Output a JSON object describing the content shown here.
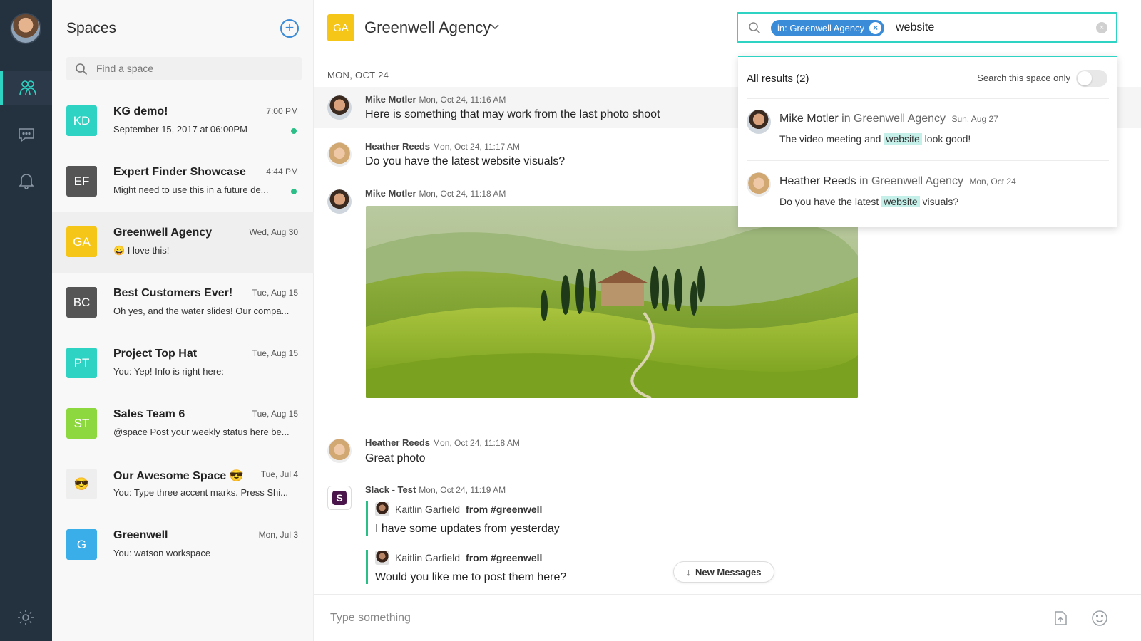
{
  "nav": {
    "items": [
      "spaces",
      "messages",
      "notifications"
    ],
    "active": "spaces"
  },
  "spaces_panel": {
    "title": "Spaces",
    "search_placeholder": "Find a space",
    "items": [
      {
        "initials": "KD",
        "name": "KG demo!",
        "time": "7:00 PM",
        "snippet": "September 15, 2017 at 06:00PM",
        "color": "#2ed3c3",
        "unread": true
      },
      {
        "initials": "EF",
        "name": "Expert Finder Showcase",
        "time": "4:44 PM",
        "snippet": "Might need to use this in a future de...",
        "color": "#555555",
        "unread": true
      },
      {
        "initials": "GA",
        "name": "Greenwell Agency",
        "time": "Wed, Aug 30",
        "snippet": "😀 I love this!",
        "color": "#f5c518",
        "unread": false
      },
      {
        "initials": "BC",
        "name": "Best Customers Ever!",
        "time": "Tue, Aug 15",
        "snippet": "Oh yes, and the water slides! Our compa...",
        "color": "#555555",
        "unread": false
      },
      {
        "initials": "PT",
        "name": "Project Top Hat",
        "time": "Tue, Aug 15",
        "snippet": "You: Yep! Info is right here:",
        "color": "#2ed3c3",
        "unread": false
      },
      {
        "initials": "ST",
        "name": "Sales Team 6",
        "time": "Tue, Aug 15",
        "snippet": "@space Post your weekly status here be...",
        "color": "#8ed83f",
        "unread": false
      },
      {
        "initials": "😎",
        "name": "Our Awesome Space 😎",
        "time": "Tue, Jul 4",
        "snippet": "You: Type three accent marks. Press Shi...",
        "color": "#eeeeee",
        "unread": false
      },
      {
        "initials": "G",
        "name": "Greenwell",
        "time": "Mon, Jul 3",
        "snippet": "You: watson workspace",
        "color": "#3aaee8",
        "unread": false
      }
    ]
  },
  "header": {
    "initials": "GA",
    "title": "Greenwell Agency"
  },
  "conversation": {
    "date_divider": "MON, OCT 24",
    "messages": [
      {
        "author": "Mike Motler",
        "time": "Mon, Oct 24, 11:16 AM",
        "text": "Here is something that may work from the last photo shoot"
      },
      {
        "author": "Heather Reeds",
        "time": "Mon, Oct 24, 11:17 AM",
        "text": "Do you have the latest website visuals?"
      },
      {
        "author": "Mike Motler",
        "time": "Mon, Oct 24, 11:18 AM",
        "text": ""
      },
      {
        "author": "Heather Reeds",
        "time": "Mon, Oct 24, 11:18 AM",
        "text": "Great photo"
      },
      {
        "author": "Slack - Test",
        "time": "Mon, Oct 24, 11:19 AM",
        "text": ""
      }
    ],
    "quotes": [
      {
        "author": "Kaitlin Garfield",
        "channel": "from #greenwell",
        "text": "I have some updates from yesterday"
      },
      {
        "author": "Kaitlin Garfield",
        "channel": "from #greenwell",
        "text": "Would you like me to post them here?"
      }
    ],
    "new_messages_label": "New Messages",
    "composer_placeholder": "Type something"
  },
  "search": {
    "scope_chip": "in: Greenwell Agency",
    "query": "website",
    "results_header": "All results (2)",
    "search_space_only_label": "Search this space only",
    "search_space_only": false,
    "results": [
      {
        "author": "Mike Motler",
        "space": "in Greenwell Agency",
        "date": "Sun, Aug 27",
        "before": "The video meeting and ",
        "match": "website",
        "after": " look good!"
      },
      {
        "author": "Heather Reeds",
        "space": "in Greenwell Agency",
        "date": "Mon, Oct 24",
        "before": "Do you have the latest ",
        "match": "website",
        "after": " visuals?"
      }
    ]
  },
  "colors": {
    "rail": "#24313f",
    "accent": "#2ed3c3",
    "chip": "#3a8bd8",
    "highlight": "#c5f0ea"
  }
}
